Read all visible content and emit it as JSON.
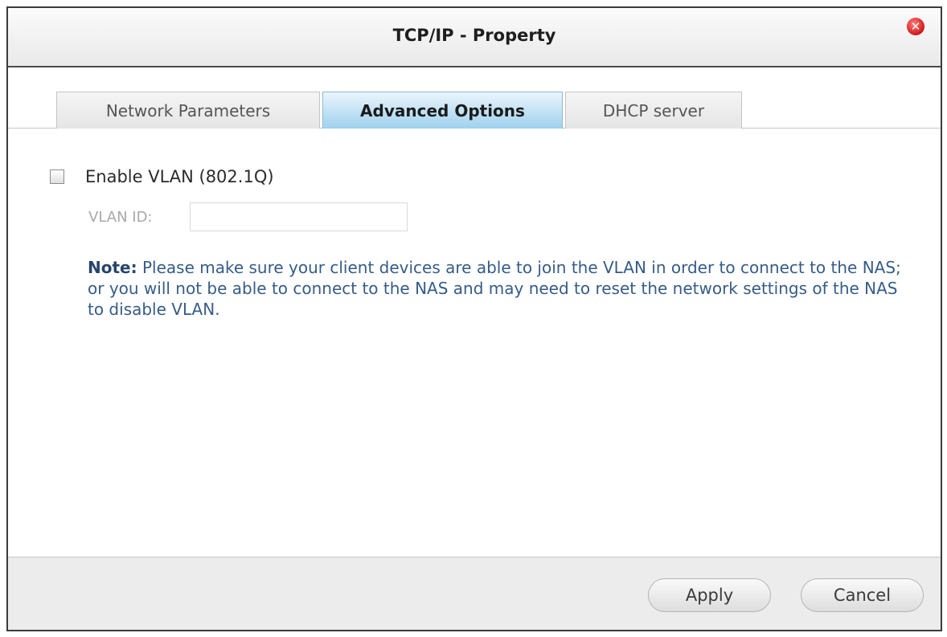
{
  "dialog": {
    "title": "TCP/IP - Property",
    "close_icon": "close-icon"
  },
  "tabs": [
    {
      "label": "Network Parameters",
      "active": false
    },
    {
      "label": "Advanced Options",
      "active": true
    },
    {
      "label": "DHCP server",
      "active": false
    }
  ],
  "vlan": {
    "enable_label": "Enable VLAN (802.1Q)",
    "enabled": false,
    "id_label": "VLAN ID:",
    "id_value": ""
  },
  "note": {
    "prefix": "Note:",
    "text": " Please make sure your client devices are able to join the VLAN in order to connect to the NAS; or you will not be able to connect to the NAS and may need to reset the network settings of the NAS to disable VLAN."
  },
  "footer": {
    "apply_label": "Apply",
    "cancel_label": "Cancel"
  },
  "colors": {
    "active_tab": "#9fd1ee",
    "note_text": "#365c86",
    "close_button": "#d01818"
  }
}
